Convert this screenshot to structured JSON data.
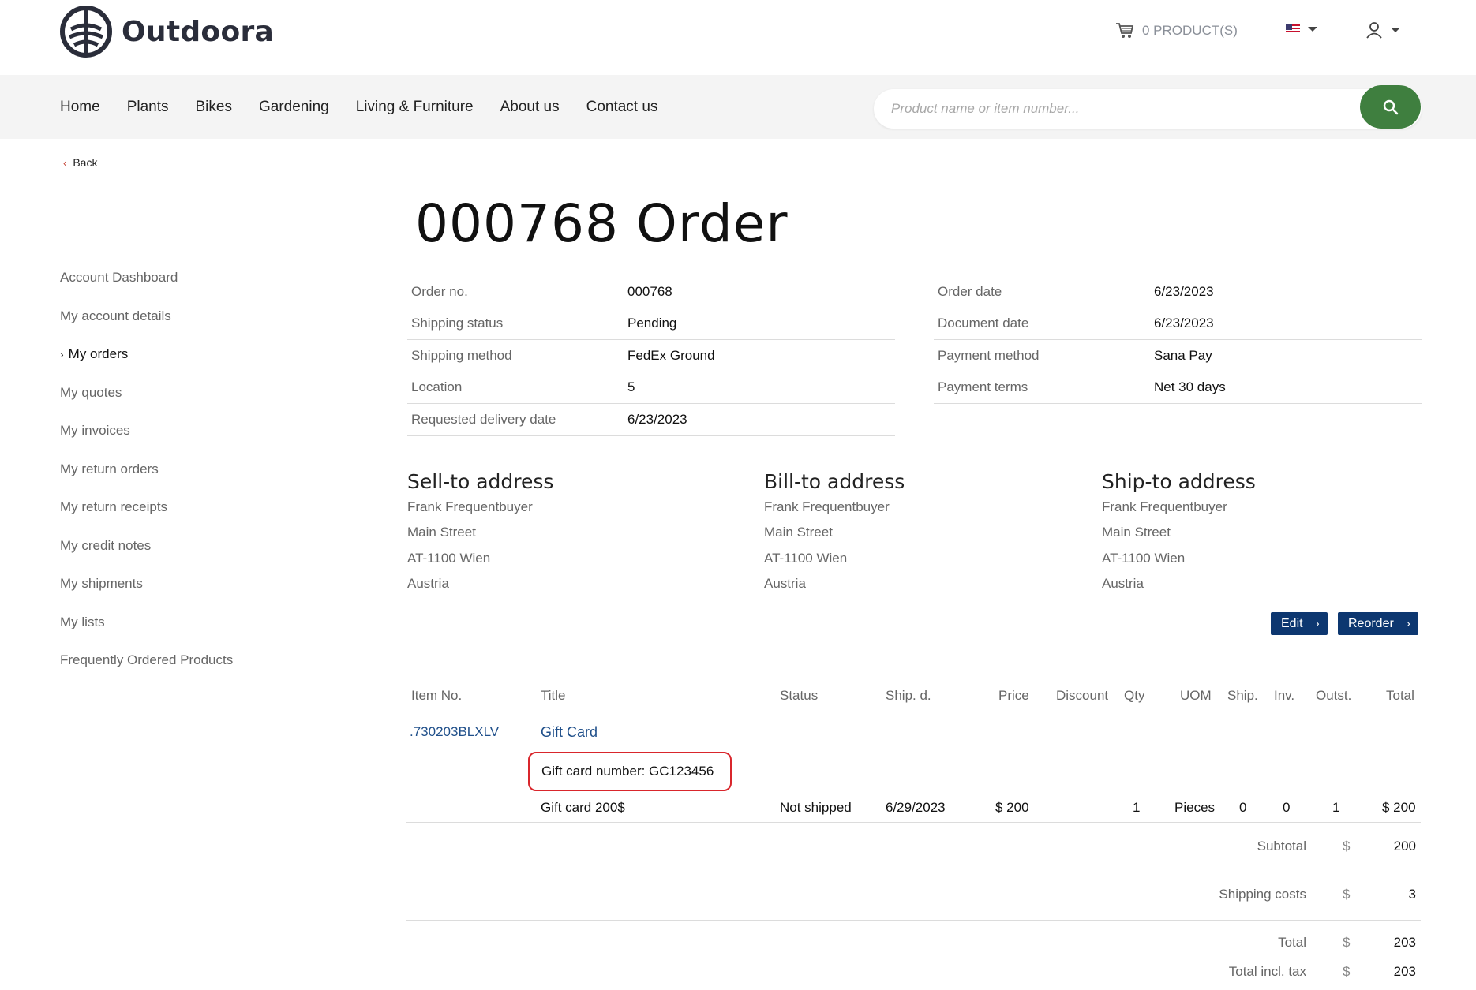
{
  "brand": {
    "name": "Outdoora"
  },
  "header": {
    "cart_label": "0 PRODUCT(S)",
    "search_placeholder": "Product name or item number..."
  },
  "nav": {
    "items": [
      "Home",
      "Plants",
      "Bikes",
      "Gardening",
      "Living & Furniture",
      "About us",
      "Contact us"
    ]
  },
  "back_label": "Back",
  "sidebar": {
    "items": [
      "Account Dashboard",
      "My account details",
      "My orders",
      "My quotes",
      "My invoices",
      "My return orders",
      "My return receipts",
      "My credit notes",
      "My shipments",
      "My lists",
      "Frequently Ordered Products"
    ],
    "active": "My orders"
  },
  "page_title": "000768 Order",
  "order_info_left": [
    {
      "label": "Order no.",
      "value": "000768"
    },
    {
      "label": "Shipping status",
      "value": "Pending"
    },
    {
      "label": "Shipping method",
      "value": "FedEx Ground"
    },
    {
      "label": "Location",
      "value": "5"
    },
    {
      "label": "Requested delivery date",
      "value": "6/23/2023"
    }
  ],
  "order_info_right": [
    {
      "label": "Order date",
      "value": "6/23/2023"
    },
    {
      "label": "Document date",
      "value": "6/23/2023"
    },
    {
      "label": "Payment method",
      "value": "Sana Pay"
    },
    {
      "label": "Payment terms",
      "value": "Net 30 days"
    }
  ],
  "addresses": [
    {
      "title": "Sell-to address",
      "lines": [
        "Frank Frequentbuyer",
        "Main Street",
        "AT-1100 Wien",
        "Austria"
      ]
    },
    {
      "title": "Bill-to address",
      "lines": [
        "Frank Frequentbuyer",
        "Main Street",
        "AT-1100 Wien",
        "Austria"
      ]
    },
    {
      "title": "Ship-to address",
      "lines": [
        "Frank Frequentbuyer",
        "Main Street",
        "AT-1100 Wien",
        "Austria"
      ]
    }
  ],
  "actions": {
    "edit": "Edit",
    "reorder": "Reorder"
  },
  "lines_table": {
    "headers": {
      "item_no": "Item No.",
      "title": "Title",
      "status": "Status",
      "ship_date": "Ship. d.",
      "price": "Price",
      "discount": "Discount",
      "qty": "Qty",
      "uom": "UOM",
      "shipped": "Ship.",
      "invoiced": "Inv.",
      "outstanding": "Outst.",
      "total": "Total"
    },
    "row": {
      "item_no": ".730203BLXLV",
      "title": "Gift Card",
      "gift_card_number": "Gift card number: GC123456",
      "variant": "Gift card 200$",
      "status": "Not shipped",
      "ship_date": "6/29/2023",
      "price": "$ 200",
      "discount": "",
      "qty": "1",
      "uom": "Pieces",
      "shipped": "0",
      "invoiced": "0",
      "outstanding": "1",
      "total": "$ 200"
    }
  },
  "totals": [
    {
      "label": "Subtotal",
      "currency": "$",
      "value": "200"
    },
    {
      "label": "Shipping costs",
      "currency": "$",
      "value": "3"
    },
    {
      "label": "Total",
      "currency": "$",
      "value": "203"
    },
    {
      "label": "Total incl. tax",
      "currency": "$",
      "value": "203"
    }
  ],
  "colors": {
    "search_button": "#3f7f3f",
    "action_button": "#0d3770",
    "highlight_border": "#d9262c",
    "link": "#1f4f8a"
  }
}
